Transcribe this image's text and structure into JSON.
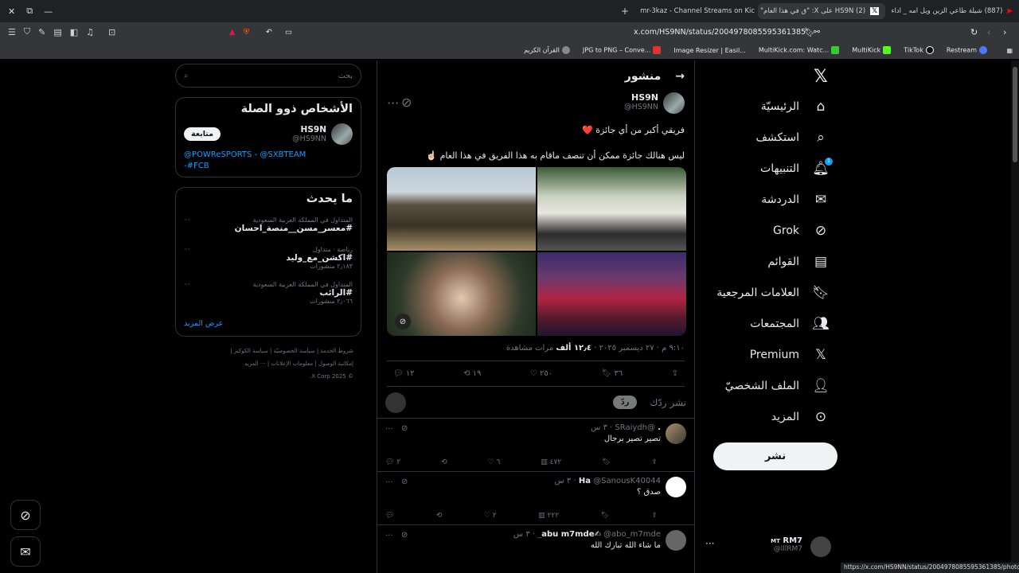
{
  "browser": {
    "tabs": [
      {
        "title": "(887) شيلة طاعي الزين ويل امه _ اداء",
        "active": false
      },
      {
        "title": "(2) HS9N على X: \"ق في هذا العام\"",
        "active": true
      },
      {
        "title": "mr-3kaz - Channel Streams on Kick",
        "active": false
      }
    ],
    "new_tab": "+",
    "url": "x.com/HS9NN/status/2004978085595361385",
    "bookmarks": [
      "القرآن الكريم",
      "JPG to PNG – Conve...",
      "Image Resizer | Easil...",
      "MultiKick.com: Watc...",
      "MultiKick",
      "TikTok",
      "Restream"
    ],
    "status_url": "https://x.com/HS9NN/status/2004978085595361385/photo/3"
  },
  "nav": {
    "items": [
      {
        "label": "الرئيسيّة",
        "icon": "home-icon"
      },
      {
        "label": "استكشف",
        "icon": "search-icon"
      },
      {
        "label": "التنبيهات",
        "icon": "bell-icon",
        "badge": "1"
      },
      {
        "label": "الدردشة",
        "icon": "envelope-icon"
      },
      {
        "label": "Grok",
        "icon": "grok-icon"
      },
      {
        "label": "القوائم",
        "icon": "list-icon"
      },
      {
        "label": "العلامات المرجعية",
        "icon": "bookmark-icon"
      },
      {
        "label": "المجتمعات",
        "icon": "people-icon"
      },
      {
        "label": "Premium",
        "icon": "x-logo-icon"
      },
      {
        "label": "الملف الشخصيّ",
        "icon": "person-icon"
      },
      {
        "label": "المزيد",
        "icon": "more-circle-icon"
      }
    ],
    "post_button": "نشر",
    "me": {
      "name": "RM7",
      "prefix": "MT",
      "handle": "@lllRM7"
    }
  },
  "header": {
    "title": "منشور"
  },
  "post": {
    "name": "HS9N",
    "handle": "@HS9NN",
    "line1": "فريقي أكبر من أي جائزة ❤️",
    "line2": "ليس هنالك جائزة ممكن أن تنصف ماقام به هذا الفريق في هذا العام ☝🏻",
    "meta": "٩:١٠ م · ٢٧ ديسمبر ٢٠٢٥ · ",
    "views": "١٢٫٤ ألف",
    "views_label": " مرات مشاهدة",
    "replies": "١٢",
    "reposts": "١٩",
    "likes": "٢٥٠",
    "bookmarks": "٣٦"
  },
  "reply_box": {
    "placeholder": "نشر ردّك",
    "button": "ردّ"
  },
  "replies": [
    {
      "name": ".",
      "handle": "@SRaiydh",
      "time": "· ٣ س",
      "text": "تصير تصير برجال",
      "replies": "٢",
      "likes": "٦",
      "views": "٤٧٢"
    },
    {
      "name": "Ha",
      "handle": "@SanousK40044",
      "time": "· ٣ س",
      "text": "صدق ؟",
      "replies": "",
      "likes": "٢",
      "views": "٢٢٢"
    },
    {
      "name": "abu m7mde✍",
      "handle": "@abo_m7mde_",
      "time": "· ٣ س",
      "text": "ما شاء الله تبارك الله",
      "replies": "",
      "likes": "",
      "views": ""
    }
  ],
  "sidebar": {
    "search_placeholder": "بحث",
    "related_title": "الأشخاص ذوو الصلة",
    "related": {
      "name": "HS9N",
      "handle": "@HS9NN",
      "follow": "متابعة",
      "bio_line1a": "@POWReSPORTS",
      "bio_sep": " - ",
      "bio_line1b": "@SXBTEAM",
      "bio_line2": "-#FCB"
    },
    "trending_title": "ما يحدث",
    "trends": [
      {
        "context": "المتداول في المملكة العربية السعودية",
        "name": "#معسر_مسن__منصة_احسان",
        "count": ""
      },
      {
        "context": "رياضة · متداول",
        "name": "#اكشن_مع_وليد",
        "count": "٢٫١٨٣ منشورات"
      },
      {
        "context": "المتداول في المملكة العربية السعودية",
        "name": "#الرائب",
        "count": "٢٫٠٦٦ منشورات"
      }
    ],
    "show_more": "عرض المزيد",
    "footer1": "شروط الخدمة | سياسة الخصوصيّة | سياسة الكوكيز |",
    "footer2": "إمكانية الوصول | معلومات الإعلانات | ··· المزيد",
    "copyright": "© 2025 X Corp."
  }
}
